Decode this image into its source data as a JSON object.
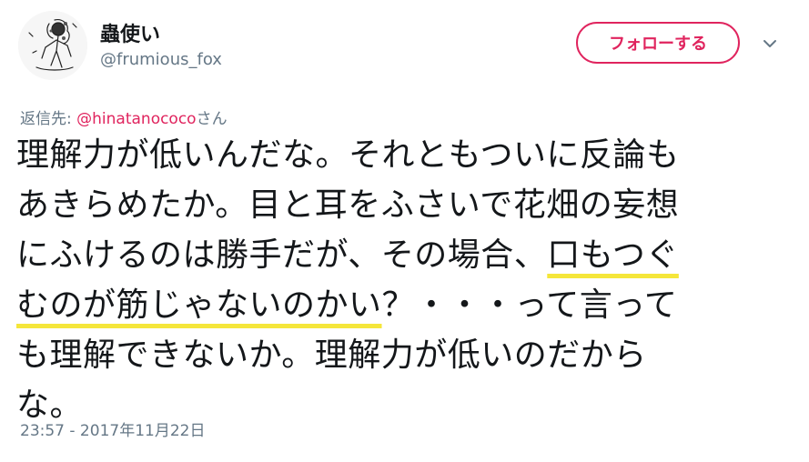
{
  "author": {
    "display_name": "蟲使い",
    "username": "@frumious_fox",
    "avatar_icon": "sketch-figure-avatar"
  },
  "follow_button": {
    "label": "フォローする",
    "color": "#e0245e"
  },
  "menu_icon": "chevron-down-icon",
  "reply_context": {
    "prefix": "返信先: ",
    "mention": "@hinatanococo",
    "suffix": "さん"
  },
  "tweet_body": {
    "line1": "理解力が低いんだな。それともついに反論も",
    "line2": "あきらめたか。目と耳をふさいで花畑の妄想",
    "line3_a": "にふけるのは勝手だが、その場合、",
    "line3_b": "口もつぐ",
    "line4_a": "むのが筋じゃないのかい",
    "line4_b": "？・・・って言って",
    "line5": "も理解できないか。理解力が低いのだから",
    "line6": "な。",
    "highlight_color": "#f5e63a"
  },
  "timestamp": "23:57 - 2017年11月22日"
}
